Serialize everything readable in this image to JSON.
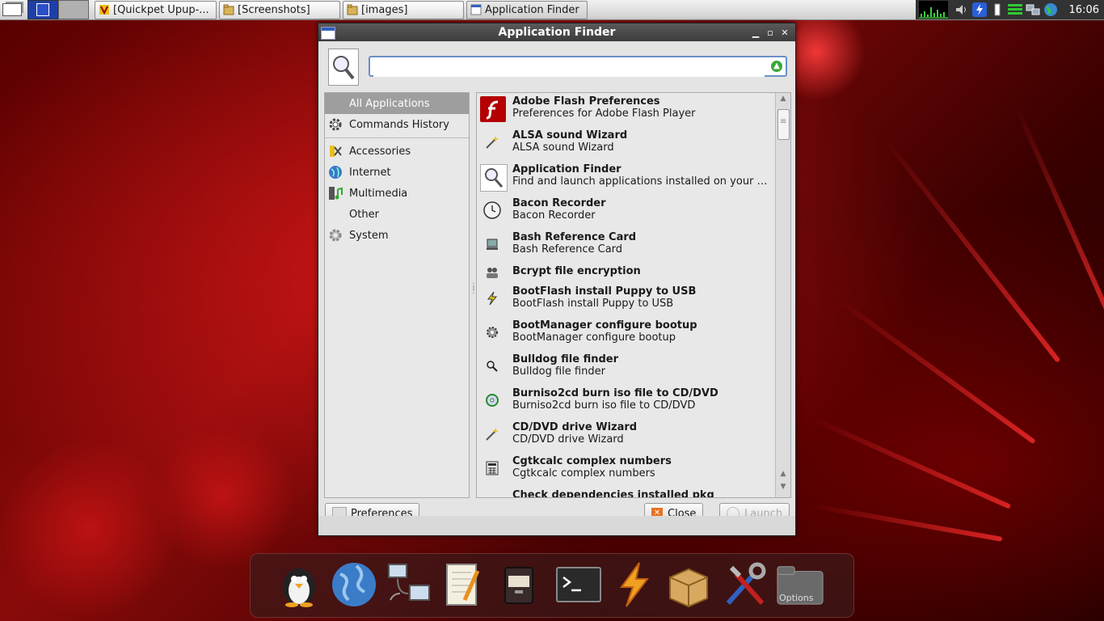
{
  "taskbar": {
    "tasks": [
      {
        "label": "[Quickpet Upup-..."
      },
      {
        "label": "[Screenshots]"
      },
      {
        "label": "[images]"
      },
      {
        "label": "Application Finder"
      }
    ],
    "clock": "16:06"
  },
  "window": {
    "title": "Application Finder",
    "search": {
      "value": "",
      "placeholder": ""
    },
    "categories": [
      {
        "label": "All Applications",
        "icon": "none",
        "selected": true
      },
      {
        "label": "Commands History",
        "icon": "gear-icon"
      },
      {
        "label": "Accessories",
        "icon": "scissors-icon"
      },
      {
        "label": "Internet",
        "icon": "globe-icon"
      },
      {
        "label": "Multimedia",
        "icon": "film-music-icon"
      },
      {
        "label": "Other",
        "icon": "none"
      },
      {
        "label": "System",
        "icon": "gear-icon"
      }
    ],
    "apps": [
      {
        "name": "Adobe Flash Preferences",
        "desc": "Preferences for Adobe Flash Player",
        "icon": "flash-icon"
      },
      {
        "name": "ALSA sound Wizard",
        "desc": "ALSA sound Wizard",
        "icon": "wand-icon"
      },
      {
        "name": "Application Finder",
        "desc": "Find and launch applications installed on your sy...",
        "icon": "magnifier-icon"
      },
      {
        "name": "Bacon Recorder",
        "desc": "Bacon Recorder",
        "icon": "clock-icon"
      },
      {
        "name": "Bash Reference Card",
        "desc": "Bash Reference Card",
        "icon": "computer-icon"
      },
      {
        "name": "Bcrypt file encryption",
        "desc": "",
        "icon": "people-icon"
      },
      {
        "name": "BootFlash install Puppy to USB",
        "desc": "BootFlash install Puppy to USB",
        "icon": "lightning-icon"
      },
      {
        "name": "BootManager configure bootup",
        "desc": "BootManager configure bootup",
        "icon": "boot-gear-icon"
      },
      {
        "name": "Bulldog file finder",
        "desc": "Bulldog file finder",
        "icon": "magnifier-small-icon"
      },
      {
        "name": "Burniso2cd burn iso file to CD/DVD",
        "desc": "Burniso2cd burn iso file to CD/DVD",
        "icon": "cd-icon"
      },
      {
        "name": "CD/DVD drive Wizard",
        "desc": "CD/DVD drive Wizard",
        "icon": "wand-icon"
      },
      {
        "name": "Cgtkcalc complex numbers",
        "desc": "Cgtkcalc complex numbers",
        "icon": "calculator-icon"
      },
      {
        "name": "Check dependencies installed pkg",
        "desc": "",
        "icon": "package-icon"
      }
    ],
    "buttons": {
      "preferences": "Preferences",
      "close": "Close",
      "launch": "Launch"
    }
  },
  "dock": {
    "items": [
      {
        "icon": "puppy-penguin-icon"
      },
      {
        "icon": "globe-icon"
      },
      {
        "icon": "network-icon"
      },
      {
        "icon": "notepad-icon"
      },
      {
        "icon": "file-cabinet-icon"
      },
      {
        "icon": "terminal-icon"
      },
      {
        "icon": "lightning-icon"
      },
      {
        "icon": "package-box-icon"
      },
      {
        "icon": "tools-icon"
      },
      {
        "icon": "options-folder-icon",
        "label": "Options"
      }
    ]
  },
  "colors": {
    "selected_category": "#9e9e9e",
    "titlebar": "#444444",
    "search_border": "#6b8fc9",
    "desktop_red": "#8a0a0a"
  }
}
